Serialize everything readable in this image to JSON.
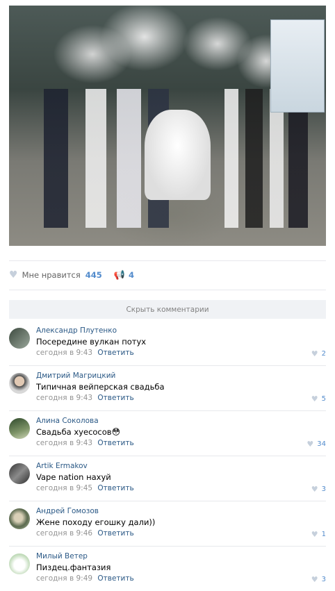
{
  "post": {
    "like_label": "Мне нравится",
    "like_count": "445",
    "share_count": "4"
  },
  "hide_comments_label": "Скрыть комментарии",
  "comments": [
    {
      "author": "Александр Плутенко",
      "text": "Посередине вулкан потух",
      "time": "сегодня в 9:43",
      "reply": "Ответить",
      "likes": "2"
    },
    {
      "author": "Дмитрий Магрицкий",
      "text": "Типичная вейперская свадьба",
      "time": "сегодня в 9:43",
      "reply": "Ответить",
      "likes": "5"
    },
    {
      "author": "Алина Соколова",
      "text": "Свадьба хуесосов",
      "time": "сегодня в 9:43",
      "reply": "Ответить",
      "likes": "34"
    },
    {
      "author": "Artik Ermakov",
      "text": "Vape nation нахуй",
      "time": "сегодня в 9:45",
      "reply": "Ответить",
      "likes": "3"
    },
    {
      "author": "Андрей Гомозов",
      "text": "Жене походу егошку дали))",
      "time": "сегодня в 9:46",
      "reply": "Ответить",
      "likes": "1"
    },
    {
      "author": "Милый Ветер",
      "text": "Пиздец.фантазия",
      "time": "сегодня в 9:49",
      "reply": "Ответить",
      "likes": "3"
    }
  ],
  "icons": {
    "like": "heart-icon",
    "share": "megaphone-icon",
    "comment_emoji": "flushed-face-emoji"
  },
  "colors": {
    "link": "#2a5885",
    "accent": "#528bcc",
    "muted": "#939393",
    "button_bg": "#f0f2f5"
  }
}
